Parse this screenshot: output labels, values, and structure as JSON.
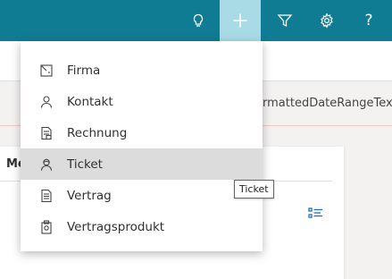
{
  "header": {
    "icons": [
      "lightbulb-icon",
      "plus-icon",
      "filter-icon",
      "gear-icon",
      "help-icon"
    ],
    "help_label": "?",
    "active_icon": "plus-icon",
    "colors": {
      "topbar": "#0f7c93",
      "active": "#a8dbe6"
    }
  },
  "content": {
    "range_text": "rmattedDateRangeText",
    "card_title": "Me"
  },
  "menu": {
    "items": [
      {
        "label": "Firma",
        "icon": "company-icon"
      },
      {
        "label": "Kontakt",
        "icon": "contact-icon"
      },
      {
        "label": "Rechnung",
        "icon": "invoice-icon"
      },
      {
        "label": "Ticket",
        "icon": "ticket-icon"
      },
      {
        "label": "Vertrag",
        "icon": "contract-icon"
      },
      {
        "label": "Vertragsprodukt",
        "icon": "contract-product-icon"
      }
    ],
    "hovered_item": "Ticket"
  },
  "tooltip": {
    "text": "Ticket"
  }
}
